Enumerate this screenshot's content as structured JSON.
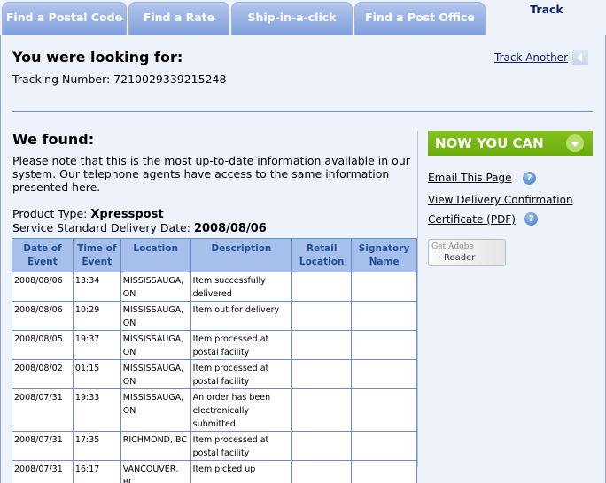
{
  "tabs": [
    {
      "label": "Find a Postal Code",
      "active": false
    },
    {
      "label": "Find a Rate",
      "active": false
    },
    {
      "label": "Ship-in-a-click",
      "active": false
    },
    {
      "label": "Find a Post Office",
      "active": false
    },
    {
      "label": "Track",
      "active": true
    }
  ],
  "search": {
    "heading": "You were looking for:",
    "tracking_label": "Tracking Number:",
    "tracking_number": "7210029339215248",
    "track_another": "Track Another",
    "back_icon": "back-arrow-icon"
  },
  "results": {
    "heading": "We found:",
    "note": "Please note that this is the most up-to-date information available in our system. Our telephone agents have access to the same information presented here.",
    "product_type_label": "Product Type:",
    "product_type": "Xpresspost",
    "delivery_date_label": "Service Standard Delivery Date:",
    "delivery_date": "2008/08/06"
  },
  "table": {
    "headers": [
      "Date of Event",
      "Time of Event",
      "Location",
      "Description",
      "Retail Location",
      "Signatory Name"
    ],
    "rows": [
      [
        "2008/08/06",
        "13:34",
        "MISSISSAUGA, ON",
        "Item successfully delivered",
        "",
        ""
      ],
      [
        "2008/08/06",
        "10:29",
        "MISSISSAUGA, ON",
        "Item out for delivery",
        "",
        ""
      ],
      [
        "2008/08/05",
        "19:37",
        "MISSISSAUGA, ON",
        "Item processed at postal facility",
        "",
        ""
      ],
      [
        "2008/08/02",
        "01:15",
        "MISSISSAUGA, ON",
        "Item processed at postal facility",
        "",
        ""
      ],
      [
        "2008/07/31",
        "19:33",
        "MISSISSAUGA, ON",
        "An order has been electronically submitted",
        "",
        ""
      ],
      [
        "2008/07/31",
        "17:35",
        "RICHMOND, BC",
        "Item processed at postal facility",
        "",
        ""
      ],
      [
        "2008/07/31",
        "16:17",
        "VANCOUVER, BC",
        "Item picked up",
        "",
        ""
      ]
    ]
  },
  "sidebar": {
    "banner": "NOW YOU CAN",
    "banner_icon": "down-arrow-icon",
    "links": [
      {
        "label": "Email This Page",
        "help": "?"
      },
      {
        "label": "View Delivery Confirmation",
        "help": ""
      },
      {
        "label": "Certificate (PDF)",
        "help": "?"
      }
    ],
    "adobe_line1": "Get Adobe",
    "adobe_line2": "Reader"
  },
  "colors": {
    "tab_gradient_top": "#b3c6ec",
    "tab_gradient_bottom": "#7f9fdc",
    "active_tab_text": "#10216b",
    "banner_green": "#7bb815",
    "table_header_bg": "#a7c0eb",
    "table_header_text": "#1f4e9a",
    "page_bg": "#edf2fb"
  }
}
